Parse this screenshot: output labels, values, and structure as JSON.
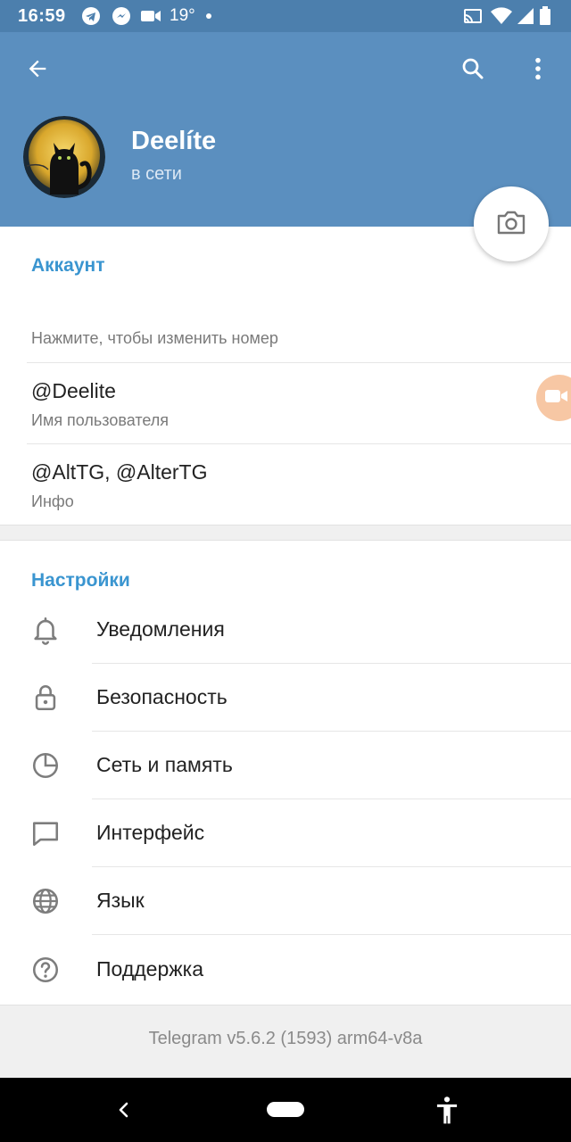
{
  "status_bar": {
    "time": "16:59",
    "temperature": "19°",
    "icons": [
      "telegram-icon",
      "messenger-icon",
      "video-icon",
      "cast-icon",
      "wifi-icon",
      "signal-icon",
      "battery-icon"
    ]
  },
  "header": {
    "back_icon": "arrow-left-icon",
    "search_icon": "search-icon",
    "menu_icon": "more-vert-icon",
    "name": "Deelíte",
    "status": "в сети",
    "camera_icon": "camera-icon"
  },
  "account": {
    "title": "Аккаунт",
    "phone_hint": "Нажмите, чтобы изменить номер",
    "username": "@Deelite",
    "username_label": "Имя пользователя",
    "bio": "@AltTG, @AlterTG",
    "bio_label": "Инфо"
  },
  "settings": {
    "title": "Настройки",
    "items": [
      {
        "label": "Уведомления",
        "icon": "bell-icon"
      },
      {
        "label": "Безопасность",
        "icon": "lock-icon"
      },
      {
        "label": "Сеть и память",
        "icon": "pie-chart-icon"
      },
      {
        "label": "Интерфейс",
        "icon": "chat-bubble-icon"
      },
      {
        "label": "Язык",
        "icon": "globe-icon"
      },
      {
        "label": "Поддержка",
        "icon": "help-icon"
      }
    ]
  },
  "footer": {
    "version": "Telegram v5.6.2 (1593) arm64-v8a"
  },
  "colors": {
    "header_bg": "#5b8fbf",
    "status_bg": "#4c7fad",
    "accent": "#3a95d0"
  }
}
